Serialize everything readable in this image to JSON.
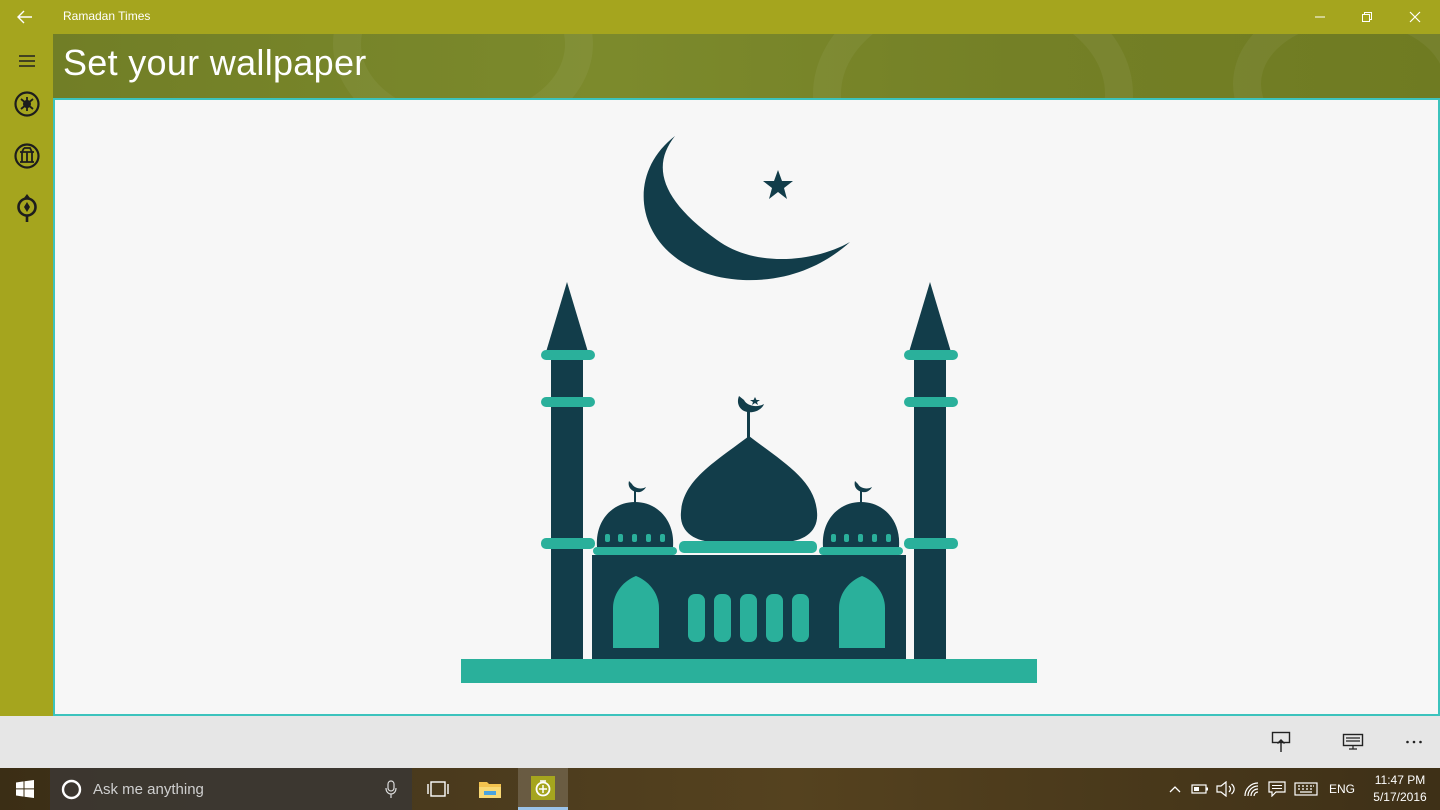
{
  "window": {
    "title": "Ramadan Times"
  },
  "header": {
    "title": "Set your wallpaper"
  },
  "nav": {
    "items": [
      {
        "icon": "hamburger-menu-icon"
      },
      {
        "icon": "sun-dial-icon"
      },
      {
        "icon": "lantern-icon"
      },
      {
        "icon": "compass-pin-icon"
      }
    ]
  },
  "taskbar": {
    "search_placeholder": "Ask me anything",
    "language": "ENG",
    "time": "11:47 PM",
    "date": "5/17/2016"
  },
  "colors": {
    "title_bar": "#a5a51e",
    "header_band": "#76832a",
    "accent_border": "#3cc3bd",
    "mosque_dark": "#123d4a",
    "mosque_teal": "#2ab09b",
    "content_bg": "#f7f7f7"
  }
}
